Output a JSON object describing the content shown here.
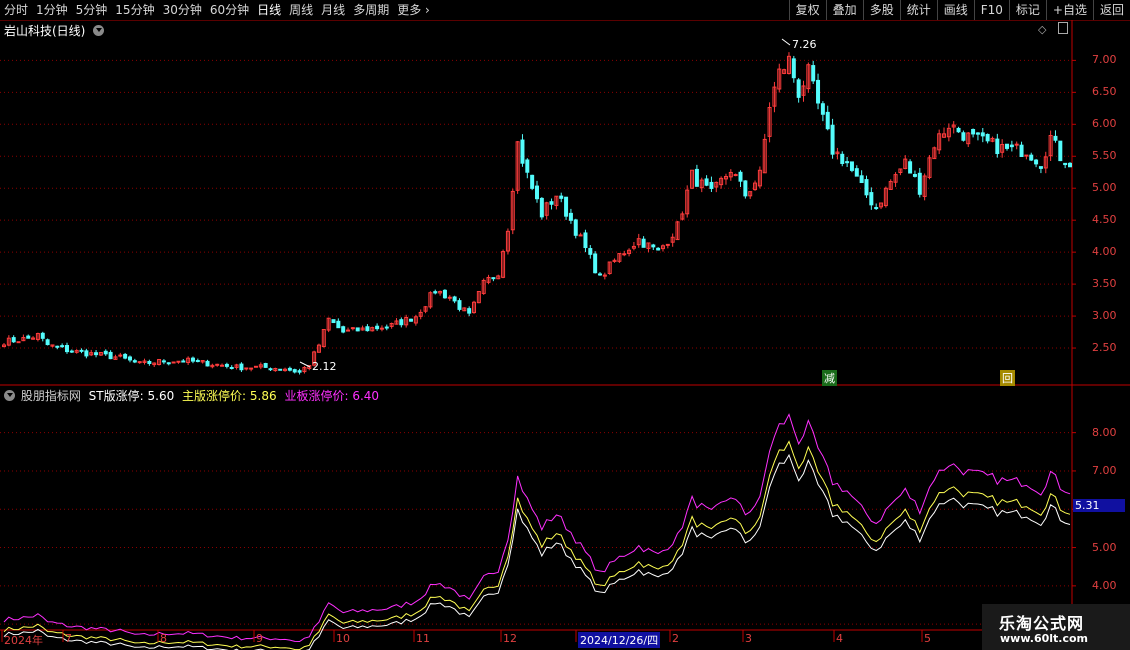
{
  "toolbar": {
    "left": [
      "分时",
      "1分钟",
      "5分钟",
      "15分钟",
      "30分钟",
      "60分钟",
      "日线",
      "周线",
      "月线",
      "多周期",
      "更多"
    ],
    "active": "日线",
    "right": [
      "复权",
      "叠加",
      "多股",
      "统计",
      "画线",
      "F10",
      "标记",
      "+自选",
      "返回"
    ]
  },
  "main_chart": {
    "title": "岩山科技(日线)",
    "high_label": "7.26",
    "low_label": "2.12",
    "markers": [
      "减",
      "回"
    ]
  },
  "indicator": {
    "name": "股朋指标网",
    "st_label": "ST版涨停:",
    "st_value": "5.60",
    "main_label": "主版涨停价:",
    "main_value": "5.86",
    "gem_label": "业板涨停价:",
    "gem_value": "6.40",
    "current_tag": "5.31"
  },
  "colors": {
    "up": "#ff3c3c",
    "down": "#54fcfc",
    "white": "#ffffff",
    "yellow": "#ffff54",
    "magenta": "#ff30ff",
    "grid": "#8b0000"
  },
  "x_axis": {
    "labels": [
      "2024年",
      "7",
      "8",
      "9",
      "10",
      "11",
      "12",
      "2024/12/26/四",
      "2",
      "3",
      "4",
      "5"
    ]
  },
  "watermark": {
    "line1": "乐淘公式网",
    "line2": "www.60lt.com"
  },
  "chart_data": [
    {
      "type": "candlestick",
      "title": "岩山科技(日线)",
      "y_ticks": [
        2.5,
        3.0,
        3.5,
        4.0,
        4.5,
        5.0,
        5.5,
        6.0,
        6.5,
        7.0
      ],
      "ylim": [
        2.0,
        7.35
      ],
      "x_months": [
        "2024年",
        "7",
        "8",
        "9",
        "10",
        "11",
        "12",
        "2",
        "3",
        "4",
        "5"
      ],
      "annotations": {
        "max": 7.26,
        "min": 2.12
      },
      "close_path": [
        [
          0,
          2.6
        ],
        [
          5,
          2.65
        ],
        [
          7,
          2.7
        ],
        [
          9,
          2.55
        ],
        [
          14,
          2.45
        ],
        [
          19,
          2.4
        ],
        [
          24,
          2.35
        ],
        [
          28,
          2.25
        ],
        [
          33,
          2.3
        ],
        [
          38,
          2.3
        ],
        [
          43,
          2.25
        ],
        [
          48,
          2.2
        ],
        [
          53,
          2.2
        ],
        [
          58,
          2.18
        ],
        [
          61,
          2.12
        ],
        [
          63,
          2.25
        ],
        [
          65,
          2.55
        ],
        [
          67,
          2.95
        ],
        [
          70,
          2.75
        ],
        [
          75,
          2.8
        ],
        [
          80,
          2.85
        ],
        [
          85,
          3.0
        ],
        [
          89,
          3.4
        ],
        [
          92,
          3.3
        ],
        [
          96,
          3.0
        ],
        [
          99,
          3.5
        ],
        [
          102,
          3.7
        ],
        [
          104,
          4.4
        ],
        [
          106,
          5.7
        ],
        [
          108,
          5.2
        ],
        [
          111,
          4.6
        ],
        [
          114,
          4.9
        ],
        [
          117,
          4.5
        ],
        [
          119,
          4.2
        ],
        [
          123,
          3.6
        ],
        [
          127,
          3.95
        ],
        [
          131,
          4.2
        ],
        [
          135,
          4.0
        ],
        [
          139,
          4.4
        ],
        [
          142,
          5.2
        ],
        [
          146,
          4.9
        ],
        [
          150,
          5.3
        ],
        [
          153,
          4.9
        ],
        [
          156,
          5.2
        ],
        [
          158,
          6.3
        ],
        [
          160,
          6.8
        ],
        [
          162,
          7.0
        ],
        [
          164,
          6.5
        ],
        [
          166,
          6.8
        ],
        [
          168,
          6.3
        ],
        [
          171,
          5.6
        ],
        [
          174,
          5.4
        ],
        [
          177,
          5.0
        ],
        [
          180,
          4.7
        ],
        [
          183,
          5.1
        ],
        [
          186,
          5.4
        ],
        [
          189,
          5.0
        ],
        [
          192,
          5.7
        ],
        [
          195,
          6.0
        ],
        [
          199,
          5.8
        ],
        [
          203,
          5.7
        ],
        [
          207,
          5.6
        ],
        [
          211,
          5.6
        ],
        [
          214,
          5.4
        ],
        [
          216,
          5.8
        ],
        [
          218,
          5.5
        ],
        [
          220,
          5.4
        ]
      ]
    },
    {
      "type": "line",
      "y_ticks": [
        3.0,
        4.0,
        5.0,
        6.0,
        7.0,
        8.0
      ],
      "ylim": [
        2.9,
        8.8
      ],
      "series": [
        {
          "name": "ST版涨停",
          "color": "#ffffff",
          "factor": 1.05
        },
        {
          "name": "主版涨停价",
          "color": "#ffff54",
          "factor": 1.1
        },
        {
          "name": "业板涨停价",
          "color": "#ff30ff",
          "factor": 1.2
        }
      ]
    }
  ]
}
